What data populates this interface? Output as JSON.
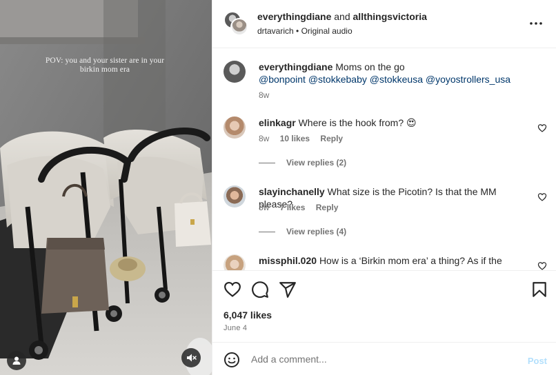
{
  "media": {
    "overlay_text": "POV: you and your sister are in your birkin mom era",
    "tag_icon": "user-tag-icon",
    "mute_icon": "speaker-muted-icon"
  },
  "header": {
    "user1": "everythingdiane",
    "and_text": " and ",
    "user2": "allthingsvictoria",
    "audio_user": "drtavarich",
    "separator": "•",
    "audio_label": "Original audio",
    "more_icon": "more-options-icon"
  },
  "caption": {
    "username": "everythingdiane",
    "text": "Moms on the go",
    "mentions": "@bonpoint @stokkebaby @stokkeusa @yoyostrollers_usa",
    "age": "8w"
  },
  "comments": [
    {
      "username": "elinkagr",
      "text": "Where is the hook from? 😍",
      "age": "8w",
      "likes": "10 likes",
      "reply": "Reply",
      "view_replies": "View replies (2)"
    },
    {
      "username": "slayinchanelly",
      "text": "What size is the Picotin? Is that the MM please?",
      "age": "8w",
      "likes": "7 likes",
      "reply": "Reply",
      "view_replies": "View replies (4)"
    },
    {
      "username": "missphil.020",
      "text": "How is a ‘Birkin mom era’ a thing? As if the"
    }
  ],
  "actions": {
    "like_icon": "heart-icon",
    "comment_icon": "comment-bubble-icon",
    "share_icon": "paper-plane-icon",
    "save_icon": "bookmark-icon",
    "likes": "6,047 likes",
    "date": "June 4"
  },
  "add_comment": {
    "emoji_icon": "emoji-smiley-icon",
    "placeholder": "Add a comment...",
    "post_label": "Post"
  },
  "colors": {
    "text": "#262626",
    "secondary": "#737373",
    "mention": "#00376b",
    "post_disabled": "#b2dffc",
    "divider": "#efefef"
  }
}
